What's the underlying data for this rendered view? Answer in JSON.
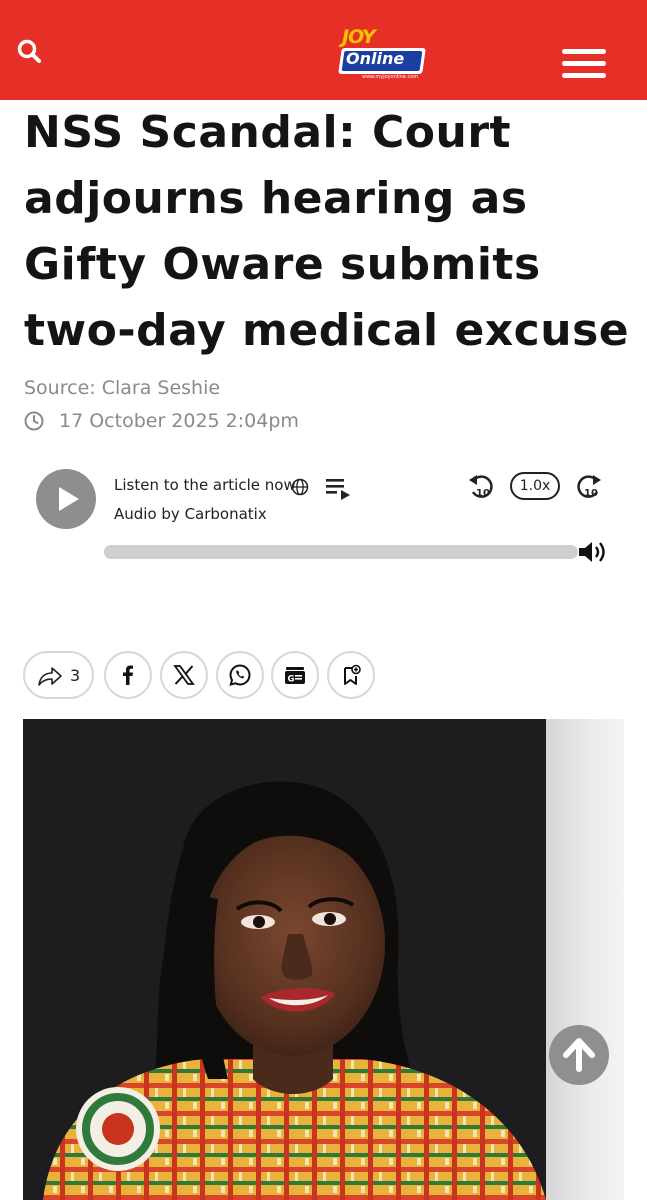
{
  "header": {
    "logo_top": "JOY",
    "logo_bottom": "Online",
    "logo_url": "www.myjoyonline.com",
    "brand_color": "#e63027",
    "search_icon": "search-icon",
    "menu_icon": "hamburger-menu-icon"
  },
  "article": {
    "title_lines": [
      "NSS Scandal: Court",
      "adjourns hearing as",
      "Gifty Oware submits",
      "two-day medical excuse"
    ],
    "source_label": "Source:",
    "source_name": "Clara Seshie",
    "date": "17 October 2025 2:04pm"
  },
  "audio": {
    "listen_label": "Listen to the article now",
    "audio_by": "Audio by Carbonatix",
    "speed": "1.0x",
    "rewind_label": "10",
    "forward_label": "10",
    "progress": 0
  },
  "share": {
    "count": "3",
    "buttons": [
      "facebook-icon",
      "x-icon",
      "whatsapp-icon",
      "google-news-icon",
      "bookmark-add-icon"
    ]
  },
  "image": {
    "alt": "",
    "side_icon": "scroll-to-top-icon"
  }
}
